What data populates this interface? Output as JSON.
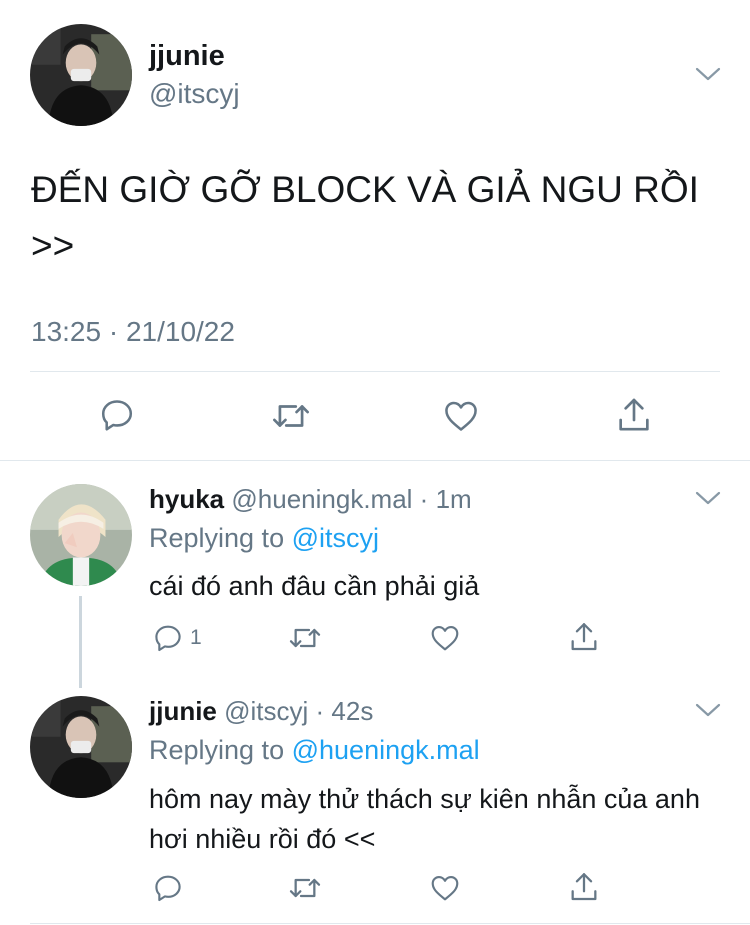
{
  "main_tweet": {
    "name": "jjunie",
    "handle": "@itscyj",
    "text": "ĐẾN GIỜ GỠ BLOCK VÀ GIẢ NGU RỒI >>",
    "timestamp": "13:25 · 21/10/22"
  },
  "replies": [
    {
      "name": "hyuka",
      "handle": "@hueningk.mal",
      "time": "1m",
      "replying_prefix": "Replying to",
      "replying_to": "@itscyj",
      "text": "cái đó anh đâu cần phải giả",
      "reply_count": "1"
    },
    {
      "name": "jjunie",
      "handle": "@itscyj",
      "time": "42s",
      "replying_prefix": "Replying to",
      "replying_to": "@hueningk.mal",
      "text": "hôm nay mày thử thách sự kiên nhẫn của anh hơi nhiều rồi đó <<"
    }
  ],
  "separator": " · ",
  "icons": [
    "chevron-down-icon",
    "reply-icon",
    "retweet-icon",
    "like-icon",
    "share-icon"
  ],
  "colors": {
    "text": "#14171a",
    "muted": "#657786",
    "link": "#1da1f2",
    "divider": "#e1e8ed"
  }
}
